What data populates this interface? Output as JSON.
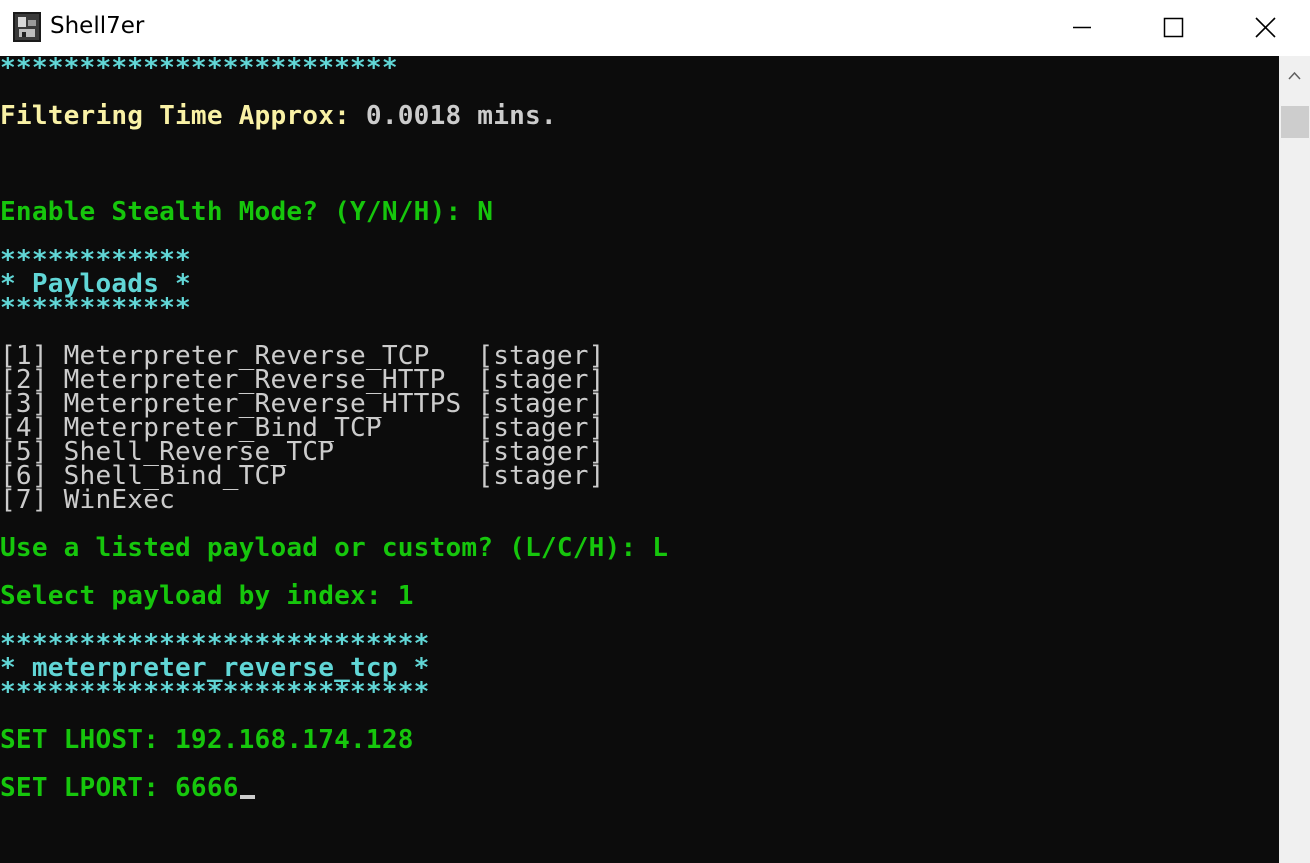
{
  "window": {
    "title": "Shell7er",
    "icon": "shell7er-app-icon",
    "controls": [
      "minimize-icon",
      "maximize-icon",
      "close-icon"
    ]
  },
  "console": {
    "colors": {
      "background": "#0c0c0c",
      "green": "#16c60c",
      "cyan": "#61d6d6",
      "yellow": "#f9f1a5",
      "white": "#cccccc"
    },
    "separator_top": "*************************",
    "filtering_label": "Filtering Time Approx:",
    "filtering_value": " 0.0018 mins.",
    "stealth_prompt": "Enable Stealth Mode? (Y/N/H): N",
    "payloads_border": "************",
    "payloads_title": "* Payloads *",
    "payload_list": [
      {
        "index": "[1]",
        "name": " Meterpreter_Reverse_TCP   ",
        "tag": "[stager]"
      },
      {
        "index": "[2]",
        "name": " Meterpreter_Reverse_HTTP  ",
        "tag": "[stager]"
      },
      {
        "index": "[3]",
        "name": " Meterpreter_Reverse_HTTPS ",
        "tag": "[stager]"
      },
      {
        "index": "[4]",
        "name": " Meterpreter_Bind_TCP      ",
        "tag": "[stager]"
      },
      {
        "index": "[5]",
        "name": " Shell_Reverse_TCP         ",
        "tag": "[stager]"
      },
      {
        "index": "[6]",
        "name": " Shell_Bind_TCP            ",
        "tag": "[stager]"
      },
      {
        "index": "[7]",
        "name": " WinExec",
        "tag": ""
      }
    ],
    "listed_prompt": "Use a listed payload or custom? (L/C/H): L",
    "select_prompt": "Select payload by index: 1",
    "selected_border": "***************************",
    "selected_title": "* meterpreter_reverse_tcp *",
    "lhost": "SET LHOST: 192.168.174.128",
    "lport": "SET LPORT: 6666"
  }
}
